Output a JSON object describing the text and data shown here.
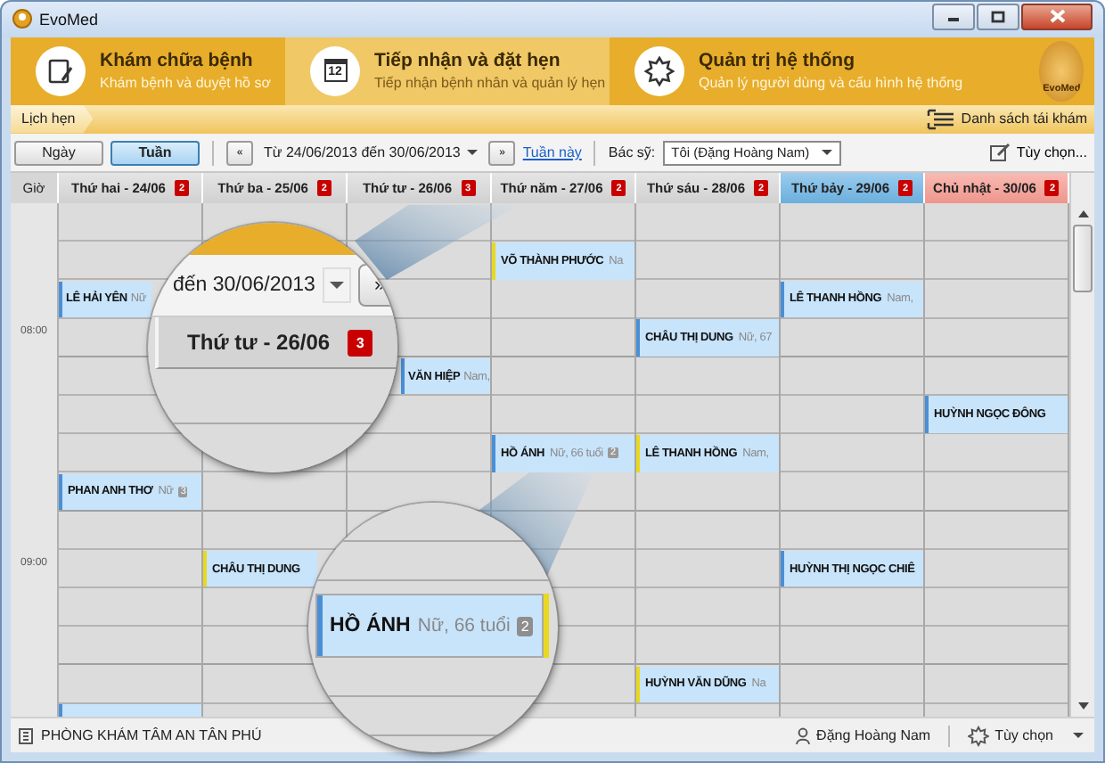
{
  "window": {
    "title": "EvoMed"
  },
  "modules": [
    {
      "kind": "notes",
      "title": "Khám chữa bệnh",
      "subtitle": "Khám bệnh và duyệt hồ sơ",
      "selected": false
    },
    {
      "kind": "calendar",
      "icon_text": "12",
      "title": "Tiếp nhận và đặt hẹn",
      "subtitle": "Tiếp nhận bệnh nhân và quản lý hẹn",
      "selected": true
    },
    {
      "kind": "gear",
      "title": "Quản trị hệ thống",
      "subtitle": "Quản lý người dùng và cấu hình hệ thống",
      "selected": false
    }
  ],
  "logo": {
    "text": "EvoMed"
  },
  "breadcrumb": "Lịch hẹn",
  "followup_button": "Danh sách tái khám",
  "view_toggle": [
    {
      "label": "Ngày",
      "selected": false
    },
    {
      "label": "Tuần",
      "selected": true
    }
  ],
  "prev_button": "«",
  "date_range": "Từ 24/06/2013 đến 30/06/2013",
  "next_button": "»",
  "this_week_link": "Tuần này",
  "doctor_label": "Bác sỹ:",
  "doctor_select": "Tôi (Đặng Hoàng Nam)",
  "options_button": "Tùy chọn...",
  "calendar": {
    "time_header": "Giờ",
    "days": [
      {
        "label": "Thứ hai - 24/06",
        "count": "2",
        "color": "#d9d9d9"
      },
      {
        "label": "Thứ ba - 25/06",
        "count": "2",
        "color": "#d9d9d9"
      },
      {
        "label": "Thứ tư - 26/06",
        "count": "3",
        "color": "#d9d9d9"
      },
      {
        "label": "Thứ năm - 27/06",
        "count": "2",
        "color": "#d9d9d9"
      },
      {
        "label": "Thứ sáu - 28/06",
        "count": "2",
        "color": "#d9d9d9"
      },
      {
        "label": "Thứ bảy - 29/06",
        "count": "2",
        "color": "#6fb6e6"
      },
      {
        "label": "Chủ nhật - 30/06",
        "count": "2",
        "color": "#f79c92"
      }
    ],
    "rows": [
      {
        "cells": [
          null,
          null,
          null,
          null,
          null,
          null,
          null
        ]
      },
      {
        "cells": [
          null,
          null,
          null,
          {
            "name": "VÕ THÀNH PHƯỚC",
            "detail": "Na",
            "color": "#e8d820"
          },
          null,
          null,
          null
        ]
      },
      {
        "cells": [
          {
            "name": "LÊ HẢI YÊN",
            "detail": "Nữ",
            "color": "#4a8fd6"
          },
          null,
          null,
          null,
          null,
          {
            "name": "LÊ THANH HỒNG",
            "detail": "Nam,",
            "color": "#4a8fd6"
          },
          null
        ]
      },
      {
        "time": "08:00",
        "cells": [
          null,
          null,
          null,
          null,
          {
            "name": "CHÂU THỊ DUNG",
            "detail": "Nữ, 67",
            "color": "#4a8fd6"
          },
          null,
          null
        ]
      },
      {
        "cells": [
          null,
          null,
          {
            "name": "VĂN HIỆP",
            "detail": "Nam,",
            "color": "#4a8fd6"
          },
          null,
          null,
          null,
          null
        ]
      },
      {
        "cells": [
          null,
          null,
          null,
          null,
          null,
          null,
          {
            "name": "HUỲNH NGỌC ĐÔNG",
            "color": "#4a8fd6"
          }
        ]
      },
      {
        "cells": [
          null,
          null,
          null,
          {
            "name": "HỒ ÁNH",
            "detail": "Nữ, 66 tuổi",
            "badge": "2",
            "color": "#4a8fd6"
          },
          {
            "name": "LÊ THANH HỒNG",
            "detail": "Nam,",
            "color": "#e8d820"
          },
          null,
          null
        ]
      },
      {
        "cells": [
          {
            "name": "PHAN ANH THƠ",
            "detail": "Nữ",
            "badge": "3",
            "color": "#4a8fd6"
          },
          null,
          null,
          null,
          null,
          null,
          null
        ]
      },
      {
        "cells": [
          null,
          null,
          null,
          null,
          null,
          null,
          null
        ]
      },
      {
        "time": "09:00",
        "cells": [
          null,
          {
            "name": "CHÂU THỊ DUNG",
            "color": "#e8d820"
          },
          null,
          null,
          null,
          {
            "name": "HUỲNH THỊ NGỌC CHIÊ",
            "color": "#4a8fd6"
          },
          null
        ]
      },
      {
        "cells": [
          null,
          null,
          null,
          null,
          null,
          null,
          null
        ]
      },
      {
        "cells": [
          null,
          null,
          null,
          null,
          null,
          null,
          null
        ]
      },
      {
        "cells": [
          null,
          null,
          null,
          null,
          {
            "name": "HUỲNH VĂN DŨNG",
            "detail": "Na",
            "color": "#e8d820"
          },
          null,
          null
        ]
      },
      {
        "cells": [
          {
            "color": "#4a8fd6"
          },
          null,
          null,
          null,
          null,
          null,
          null
        ]
      }
    ]
  },
  "magnifiers": [
    {
      "kind": "header",
      "date_text": "đến 30/06/2013",
      "next_button": "»",
      "day_label": "Thứ tư - 26/06",
      "count": "3"
    },
    {
      "kind": "appointment",
      "name": "HỒ ÁNH",
      "detail": "Nữ, 66 tuổi",
      "badge": "2"
    }
  ],
  "status_bar": {
    "clinic": "PHÒNG KHÁM TÂM AN TÂN PHÚ",
    "user": "Đặng Hoàng Nam",
    "options": "Tùy chọn"
  }
}
